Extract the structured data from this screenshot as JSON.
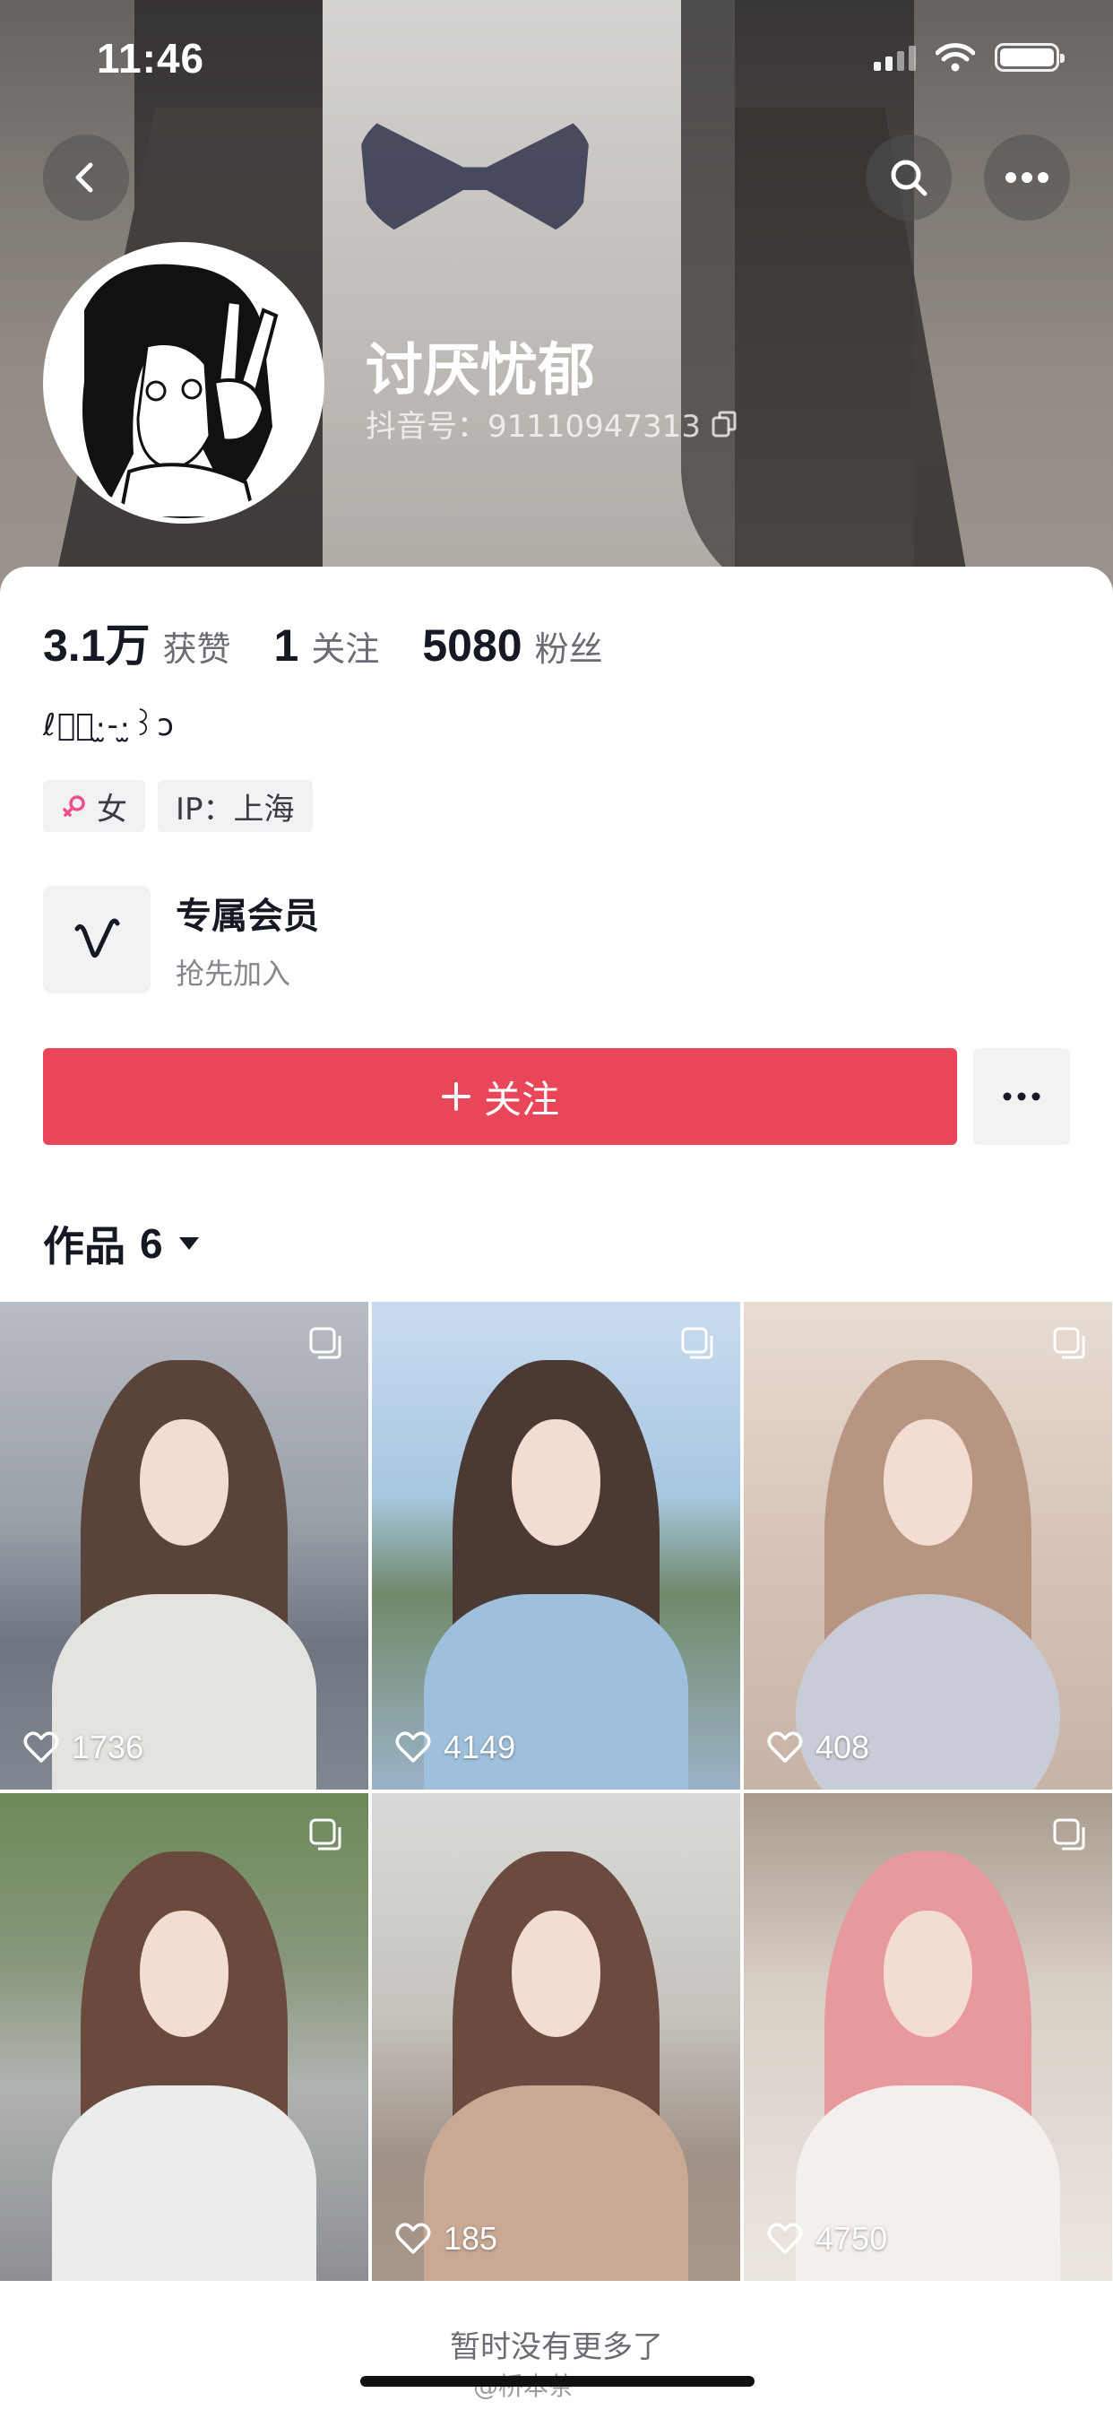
{
  "status_bar": {
    "time": "11:46"
  },
  "profile": {
    "name": "讨厌忧郁",
    "douyin_id": "抖音号：91110947313",
    "bio": "ℓ꒰ͬ·̫-·̫꒱ɔ",
    "tags": [
      {
        "icon": "female-icon",
        "label": "女"
      },
      {
        "label": "IP：上海"
      }
    ]
  },
  "stats": [
    {
      "value": "3.1万",
      "label": "获赞"
    },
    {
      "value": "1",
      "label": "关注"
    },
    {
      "value": "5080",
      "label": "粉丝"
    }
  ],
  "membership": {
    "title": "专属会员",
    "subtitle": "抢先加入"
  },
  "actions": {
    "follow_label": "关注"
  },
  "works": {
    "tab_label": "作品",
    "count": "6",
    "items": [
      {
        "likes": "1736"
      },
      {
        "likes": "4149"
      },
      {
        "likes": "408"
      },
      {
        "likes": "185"
      },
      {
        "likes": "4750"
      }
    ]
  },
  "footer": {
    "note": "暂时没有更多了",
    "watermark": "@桥本茶"
  },
  "colors": {
    "accent": "#e9465a",
    "text": "#161823",
    "muted": "#6b6d74"
  }
}
